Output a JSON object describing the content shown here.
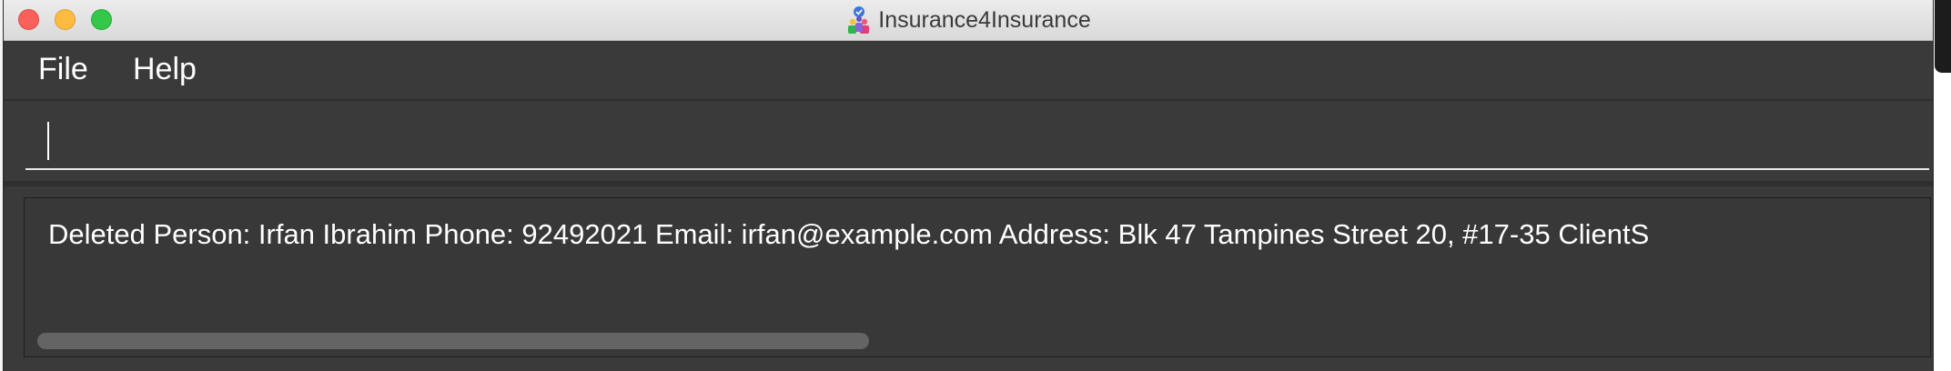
{
  "window": {
    "title": "Insurance4Insurance",
    "app_icon": "address-book-people-icon",
    "controls": [
      "close-button",
      "minimize-button",
      "maximize-button"
    ]
  },
  "menu": {
    "items": [
      {
        "label": "File"
      },
      {
        "label": "Help"
      }
    ]
  },
  "command_box": {
    "value": "",
    "placeholder": ""
  },
  "result_display": {
    "text": "Deleted Person: Irfan Ibrahim Phone: 92492021 Email: irfan@example.com Address: Blk 47 Tampines Street 20, #17-35 ClientS"
  },
  "colors": {
    "window_bg": "#3c3c3c",
    "titlebar": "#e4e4e4",
    "close": "#fc605b",
    "minimize": "#fdbc40",
    "maximize": "#34c84a",
    "text": "#ffffff",
    "scrollbar": "#646464"
  }
}
